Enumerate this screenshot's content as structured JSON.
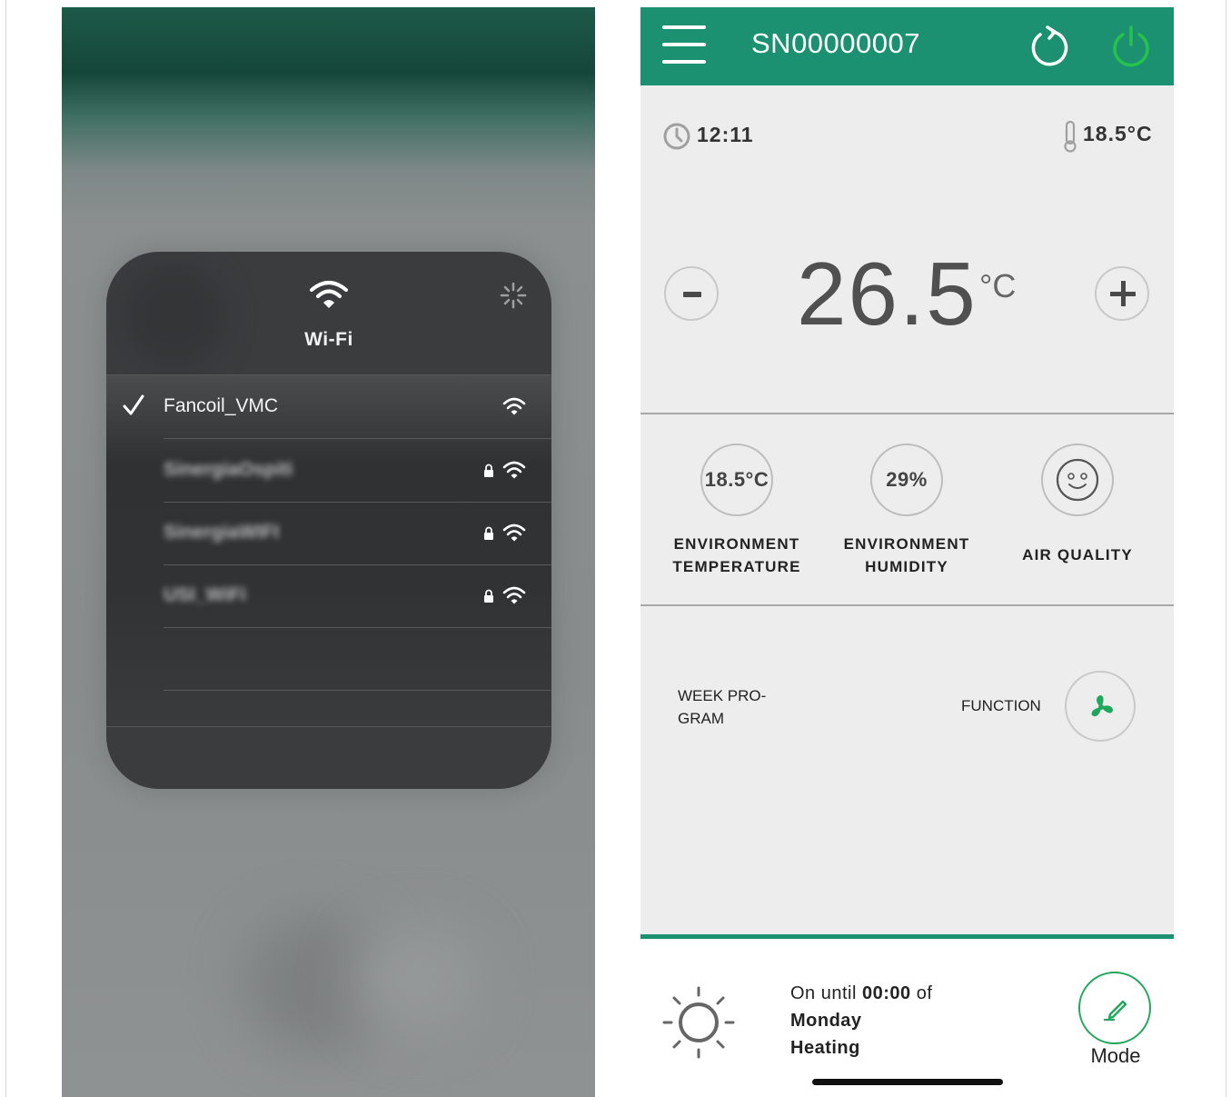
{
  "wifi_panel": {
    "title": "Wi-Fi",
    "networks": [
      {
        "name": "Fancoil_VMC",
        "connected": true,
        "locked": false
      },
      {
        "name": "SinergiaOspiti",
        "connected": false,
        "locked": true
      },
      {
        "name": "SinergiaWIFI",
        "connected": false,
        "locked": true
      },
      {
        "name": "USI_WiFi",
        "connected": false,
        "locked": true
      }
    ]
  },
  "app": {
    "colors": {
      "header": "#1b9172",
      "power": "#27c24c",
      "mode": "#1fa85b"
    },
    "header": {
      "serial": "SN00000007"
    },
    "status": {
      "time": "12:11",
      "temperature": "18.5°C"
    },
    "setpoint": {
      "value": "26.5",
      "unit": "°C",
      "minus_icon": "minus-icon",
      "plus_icon": "plus-icon"
    },
    "stats": [
      {
        "value": "18.5°C",
        "label_line1": "ENVIRONMENT",
        "label_line2": "TEMPERATURE"
      },
      {
        "value": "29%",
        "label_line1": "ENVIRONMENT",
        "label_line2": "HUMIDITY"
      },
      {
        "icon": "smiley-icon",
        "label": "AIR QUALITY"
      }
    ],
    "week_program": {
      "line1": "WEEK PRO-",
      "line2": "GRAM"
    },
    "function": {
      "label": "FUNCTION",
      "icon": "fan-icon"
    },
    "schedule": {
      "prefix": "On until ",
      "time": "00:00",
      "suffix": " of",
      "day": "Monday",
      "mode": "Heating"
    },
    "mode_button": {
      "label": "Mode",
      "icon": "pencil-icon"
    }
  }
}
